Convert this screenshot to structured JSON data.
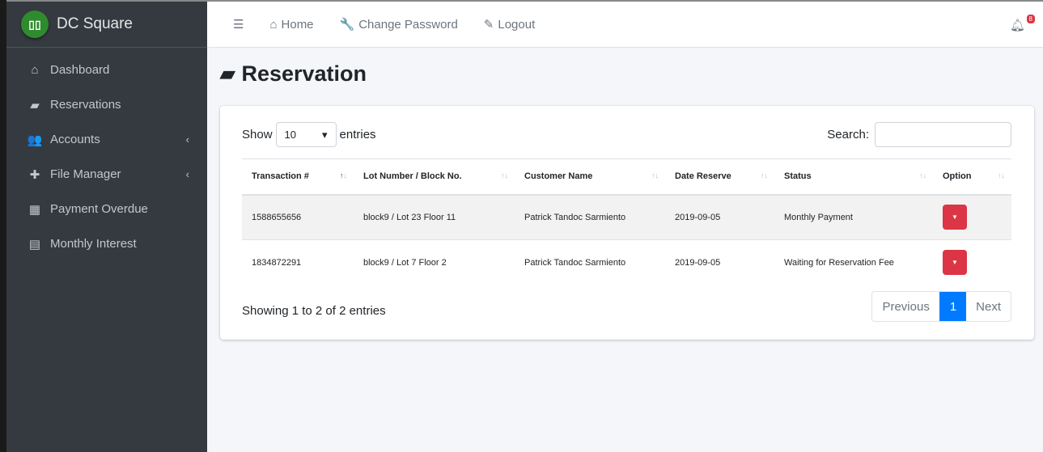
{
  "brand": {
    "name": "DC Square",
    "logo": "DC"
  },
  "sidebar": {
    "items": [
      {
        "label": "Dashboard",
        "icon": "home-icon",
        "glyph": "⌂"
      },
      {
        "label": "Reservations",
        "icon": "book-icon",
        "glyph": "▰"
      },
      {
        "label": "Accounts",
        "icon": "users-icon",
        "glyph": "👥",
        "chevron": "‹"
      },
      {
        "label": "File Manager",
        "icon": "plus-icon",
        "glyph": "✚",
        "chevron": "‹"
      },
      {
        "label": "Payment Overdue",
        "icon": "grid-icon",
        "glyph": "▦"
      },
      {
        "label": "Monthly Interest",
        "icon": "calendar-icon",
        "glyph": "▤"
      }
    ]
  },
  "topbar": {
    "menu": "☰",
    "home": "Home",
    "change_password": "Change Password",
    "logout": "Logout",
    "notifications": "8"
  },
  "page": {
    "title": "Reservation"
  },
  "table_controls": {
    "show": "Show",
    "entries_value": "10",
    "entries": "entries",
    "search": "Search:"
  },
  "table": {
    "headers": [
      "Transaction #",
      "Lot Number / Block No.",
      "Customer Name",
      "Date Reserve",
      "Status",
      "Option"
    ],
    "rows": [
      [
        "1588655656",
        "block9 / Lot 23 Floor 11",
        "Patrick Tandoc Sarmiento",
        "2019-09-05",
        "Monthly Payment"
      ],
      [
        "1834872291",
        "block9 / Lot 7 Floor 2",
        "Patrick Tandoc Sarmiento",
        "2019-09-05",
        "Waiting for Reservation Fee"
      ]
    ]
  },
  "footer": {
    "info": "Showing 1 to 2 of 2 entries",
    "previous": "Previous",
    "page": "1",
    "next": "Next"
  },
  "colors": {
    "sidebar": "#343a40",
    "danger": "#dc3545",
    "primary": "#007bff",
    "brand_logo": "#2e8b2e"
  }
}
